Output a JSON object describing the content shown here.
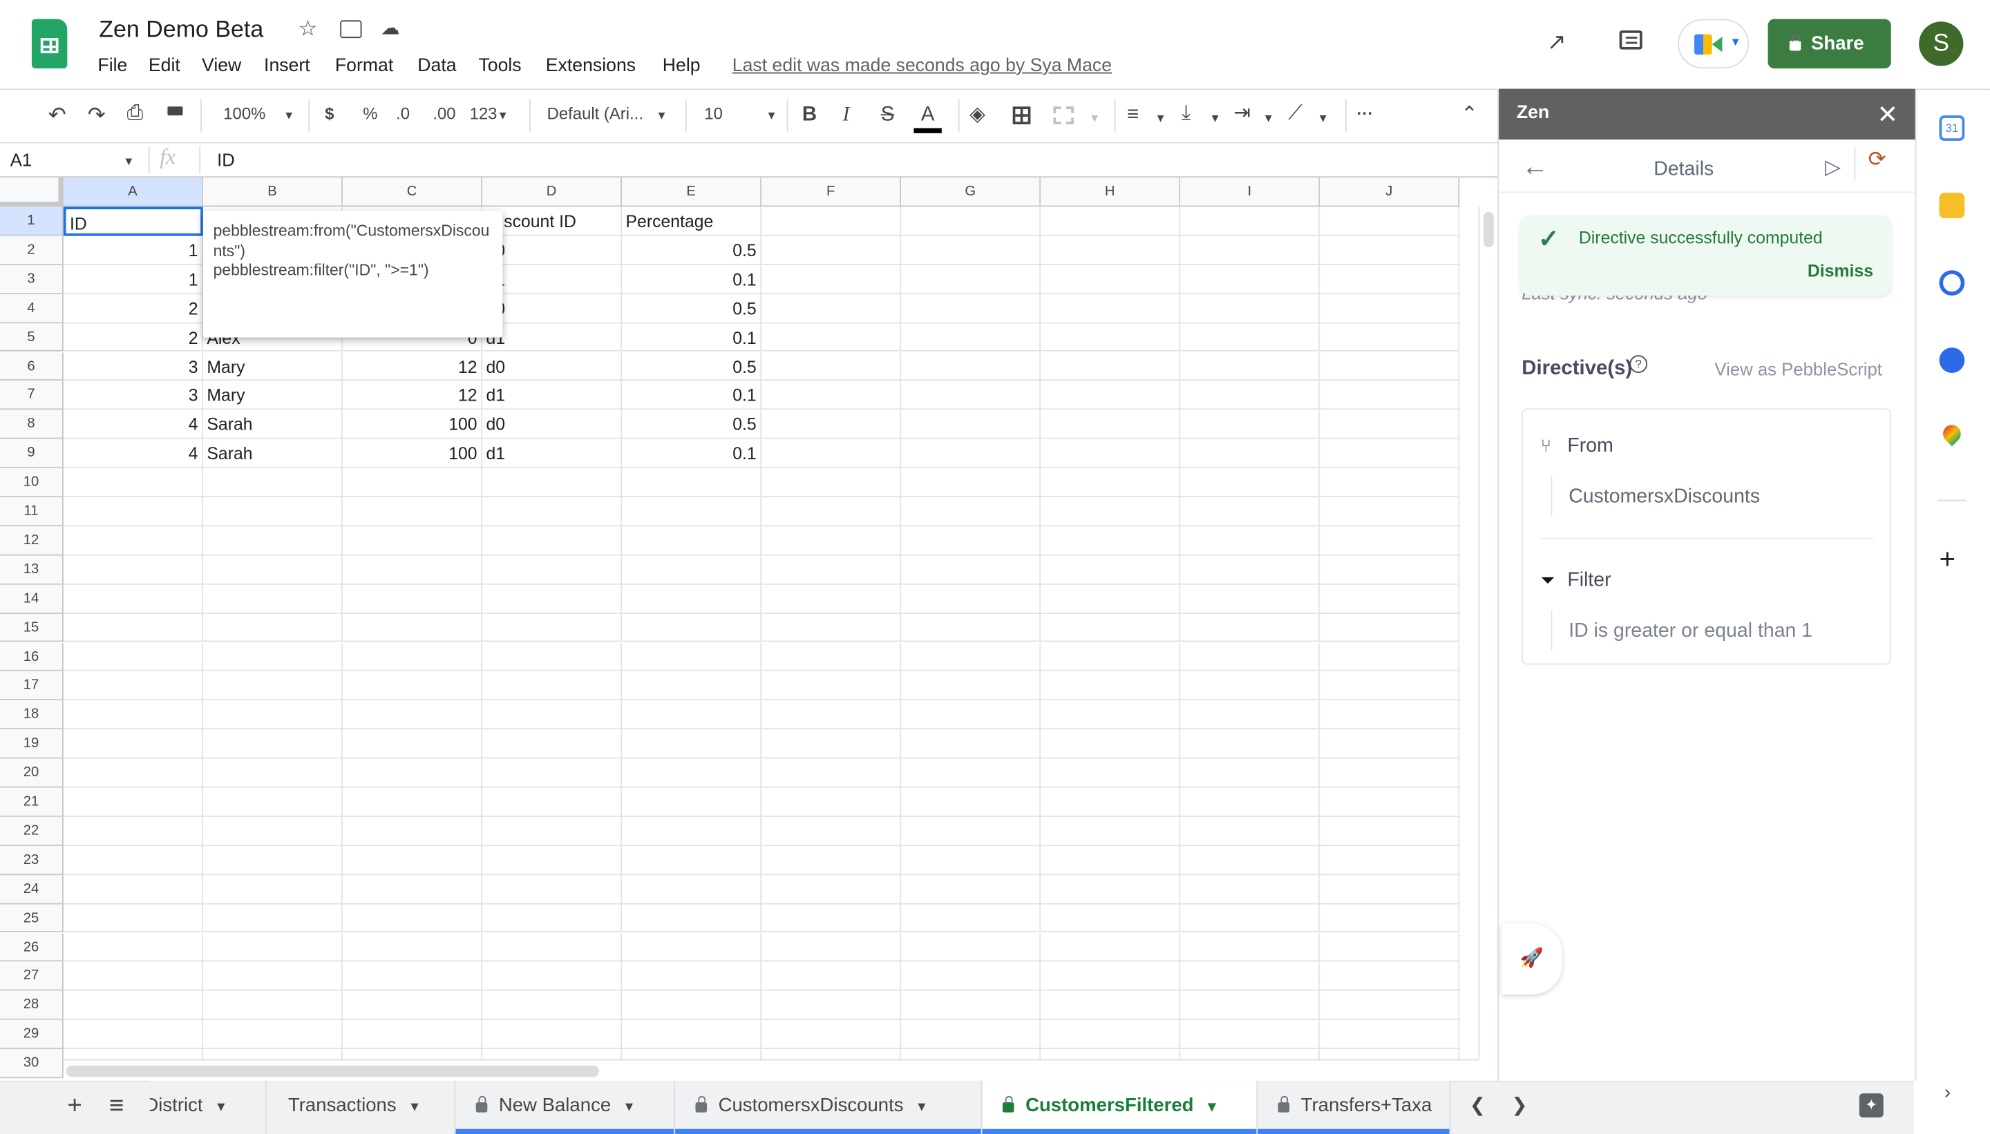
{
  "doc": {
    "title": "Zen Demo Beta",
    "last_edit": "Last edit was made seconds ago by Sya Mace"
  },
  "menu": [
    "File",
    "Edit",
    "View",
    "Insert",
    "Format",
    "Data",
    "Tools",
    "Extensions",
    "Help"
  ],
  "header": {
    "share_label": "Share",
    "avatar_initial": "S",
    "share_color": "#3b7d41",
    "avatar_color": "#3e6b2a"
  },
  "toolbar": {
    "zoom": "100%",
    "currency": "$",
    "percent": "%",
    "dec_less": ".0",
    "dec_more": ".00",
    "format": "123",
    "font": "Default (Ari...",
    "font_size": "10",
    "bold": "B",
    "italic": "I",
    "strike": "S",
    "text_color": "A",
    "more": "···"
  },
  "formula_bar": {
    "cell_ref": "A1",
    "fx": "fx",
    "value": "ID"
  },
  "grid": {
    "columns": [
      "A",
      "B",
      "C",
      "D",
      "E",
      "F",
      "G",
      "H",
      "I",
      "J"
    ],
    "row_count": 30,
    "rows": [
      [
        "ID",
        "",
        "",
        "scount ID",
        "Percentage"
      ],
      [
        "1",
        "",
        "",
        "d0",
        "0.5"
      ],
      [
        "1",
        "",
        "",
        "d1",
        "0.1"
      ],
      [
        "2",
        "",
        "",
        "d0",
        "0.5"
      ],
      [
        "2",
        "Alex",
        "0",
        "d1",
        "0.1"
      ],
      [
        "3",
        "Mary",
        "12",
        "d0",
        "0.5"
      ],
      [
        "3",
        "Mary",
        "12",
        "d1",
        "0.1"
      ],
      [
        "4",
        "Sarah",
        "100",
        "d0",
        "0.5"
      ],
      [
        "4",
        "Sarah",
        "100",
        "d1",
        "0.1"
      ]
    ],
    "note": "pebblestream:from(\"CustomersxDiscounts\")\npebblestream:filter(\"ID\", \">=1\")"
  },
  "sheet_tabs": [
    {
      "label": "District",
      "locked": false,
      "active": false
    },
    {
      "label": "Transactions",
      "locked": false,
      "active": false
    },
    {
      "label": "New Balance",
      "locked": true,
      "active": false
    },
    {
      "label": "CustomersxDiscounts",
      "locked": true,
      "active": false
    },
    {
      "label": "CustomersFiltered",
      "locked": true,
      "active": true
    },
    {
      "label": "Transfers+Taxa",
      "locked": true,
      "active": false
    }
  ],
  "panel": {
    "title": "Zen",
    "subtitle": "Details",
    "toast": {
      "message": "Directive successfully computed",
      "dismiss": "Dismiss"
    },
    "last_sync": "Last sync: seconds ago",
    "directives_label": "Directive(s)",
    "view_as": "View as PebbleScript",
    "directives": [
      {
        "type": "From",
        "icon": "branch-icon",
        "detail": "CustomersxDiscounts"
      },
      {
        "type": "Filter",
        "icon": "filter-icon",
        "detail": "ID is greater or equal than 1"
      }
    ]
  },
  "colors": {
    "accent_green": "#188038",
    "toast_bg": "#eef9f1",
    "panel_header": "#616161",
    "selection_blue": "#1a73e8"
  }
}
